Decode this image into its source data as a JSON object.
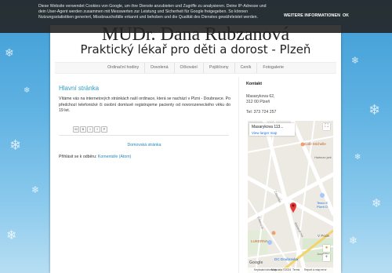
{
  "cookie": {
    "message": "Diese Website verwendet Cookies von Google, um ihre Dienste anzubieten und Zugriffe zu analysieren. Deine IP-Adresse und dein User-Agent werden zusammen mit Messwerten zur Leistung und Sicherheit für Google freigegeben. So können Nutzungsstatistiken generiert, Missbrauchsfälle erkannt und behoben und die Qualität des Dienstes gewährleistet werden.",
    "more_label": "WEITERE INFORMATIONEN",
    "ok_label": "OK"
  },
  "header": {
    "title": "MUDr. Dana Rubzanová",
    "subtitle": "Praktický lékař pro děti a dorost - Plzeň"
  },
  "nav": {
    "items": [
      "Ordinační hodiny",
      "Dovolená",
      "Očkování",
      "Pojišťovny",
      "Ceník",
      "Fotogalerie"
    ]
  },
  "post": {
    "title": "Hlavní stránka",
    "body": "Vítáme vás na internetových stránkách naší ordinace, která se nachází v Plzni - Doubravce. Po předchozí telefonické či osobní domluvě registrujeme pacienty od novorozeneckého věku do 19 let.",
    "share_icons": [
      "M",
      "B",
      "t",
      "f",
      "P"
    ],
    "home_link": "Domovská stránka",
    "comments_prefix": "Přihlásit se k odběru:",
    "comments_link": "Komentáře (Atom)"
  },
  "sidebar": {
    "heading": "Kontakt",
    "address_line1": "Masarykova 62,",
    "address_line2": "312 00 Plzeň",
    "tel": "Tel: 373 724 257"
  },
  "map": {
    "place_name": "Masarykova 113...",
    "view_larger": "View larger map",
    "labels": {
      "cafe": "Café Michelle",
      "hartman": "Hartman jark",
      "tesco": "Tesco E Plzeň D",
      "lukerna": "LUKERNA",
      "dc": "DC Doubravka",
      "vpode": "V Pode",
      "masarykova": "Masarykova",
      "zaborska": "Záborská",
      "erbenova": "Erbenova",
      "josef": "Josef-Bo"
    },
    "footer": {
      "keyboard": "Keyboard shortcuts",
      "data": "Map data ©2024",
      "terms": "Terms",
      "report": "Report a map error"
    },
    "brand": "Google",
    "accent_color": "#e53935"
  }
}
